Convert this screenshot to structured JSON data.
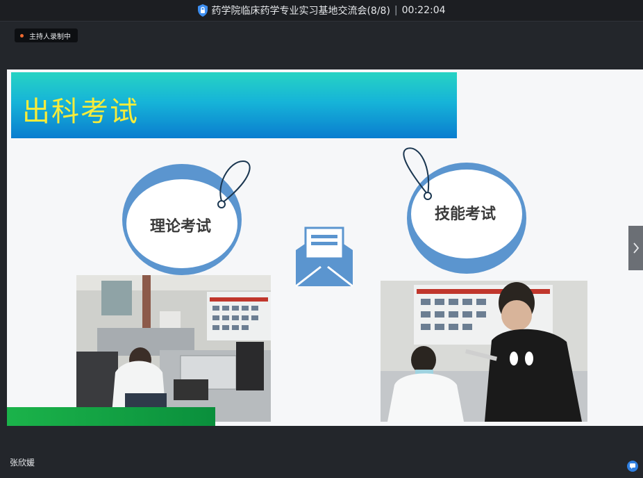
{
  "window": {
    "title": "药学院临床药学专业实习基地交流会(8/8)",
    "separator": "|",
    "elapsed": "00:22:04",
    "lock_icon": "shield-lock-icon"
  },
  "recording": {
    "label": "主持人录制中",
    "dot_color": "#f06a30"
  },
  "slide": {
    "title": "出科考试",
    "bubbles": [
      {
        "label": "理论考试"
      },
      {
        "label": "技能考试"
      }
    ],
    "center_icon": "envelope-icon",
    "photos": [
      "exam-room-photo",
      "skill-test-photo"
    ],
    "brand_color": "#5b95cf"
  },
  "controls": {
    "next_icon": "chevron-right-icon",
    "chat_icon": "chat-icon"
  },
  "participant": {
    "name": "张欣媛"
  }
}
